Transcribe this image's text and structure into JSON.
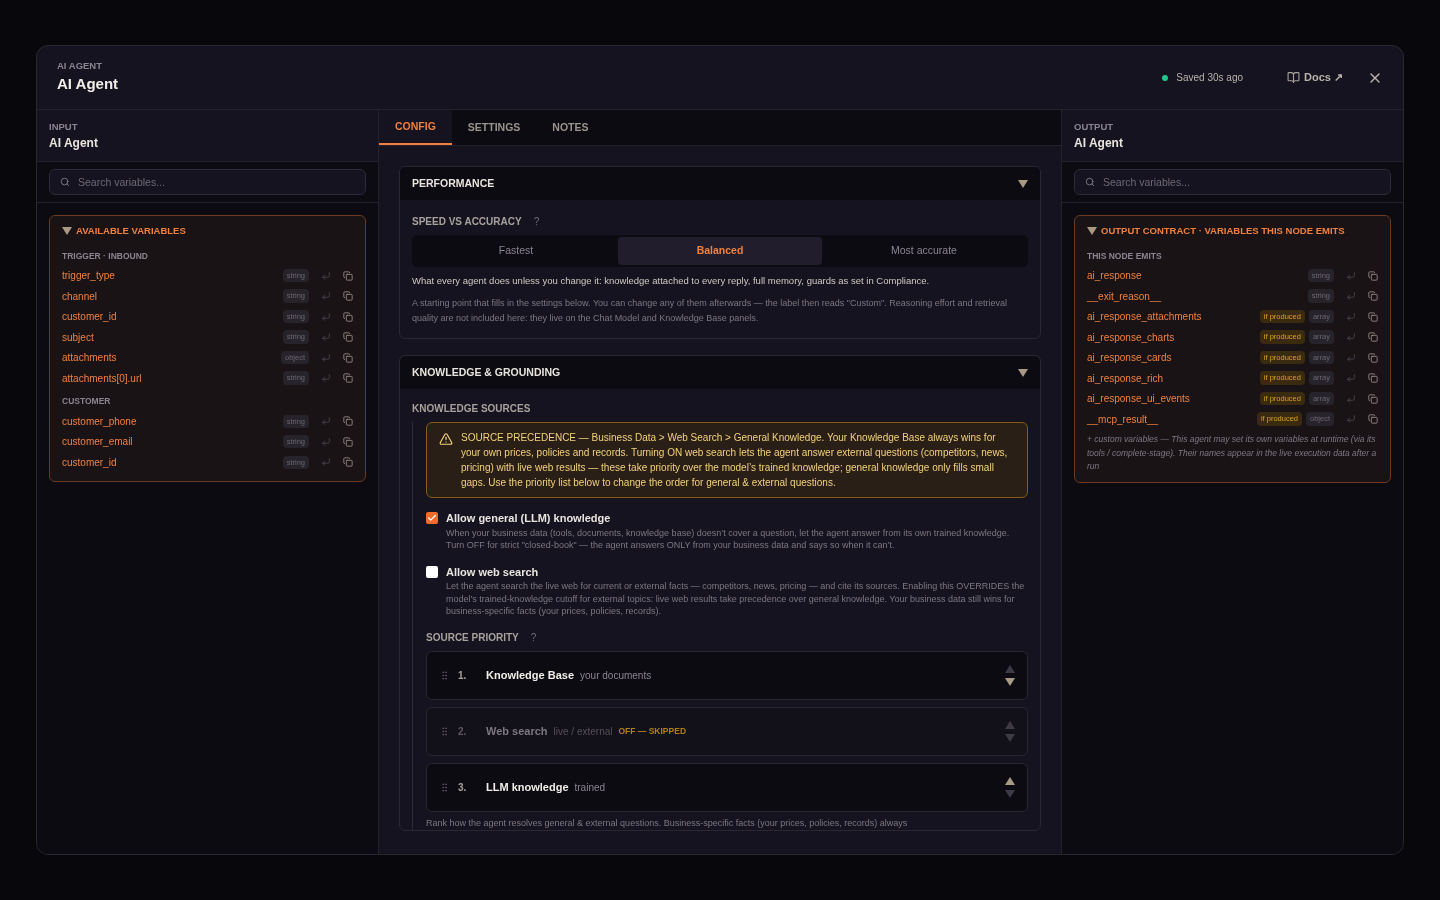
{
  "header": {
    "eyebrow": "AI AGENT",
    "title": "AI Agent",
    "status": "Saved 30s ago",
    "docs_link": "Docs ↗"
  },
  "input_panel": {
    "eyebrow": "INPUT",
    "title": "AI Agent",
    "search_placeholder": "Search variables...",
    "section_title": "AVAILABLE VARIABLES",
    "expanded": true,
    "groups": [
      {
        "label": "TRIGGER · INBOUND",
        "variables": [
          {
            "name": "trigger_type",
            "type": "string"
          },
          {
            "name": "channel",
            "type": "string"
          },
          {
            "name": "customer_id",
            "type": "string"
          },
          {
            "name": "subject",
            "type": "string"
          },
          {
            "name": "attachments",
            "type": "object"
          },
          {
            "name": "attachments[0].url",
            "type": "string"
          }
        ]
      },
      {
        "label": "CUSTOMER",
        "variables": [
          {
            "name": "customer_phone",
            "type": "string"
          },
          {
            "name": "customer_email",
            "type": "string"
          },
          {
            "name": "customer_id",
            "type": "string"
          }
        ]
      }
    ]
  },
  "tabs": [
    {
      "label": "CONFIG",
      "selected": true
    },
    {
      "label": "SETTINGS",
      "selected": false
    },
    {
      "label": "NOTES",
      "selected": false
    }
  ],
  "performance": {
    "title": "PERFORMANCE",
    "expanded": true,
    "field_label": "SPEED VS ACCURACY",
    "help": "?",
    "options": [
      {
        "label": "Fastest",
        "selected": false
      },
      {
        "label": "Balanced",
        "selected": true
      },
      {
        "label": "Most accurate",
        "selected": false
      }
    ],
    "summary": "What every agent does unless you change it: knowledge attached to every reply, full memory, guards as set in Compliance.",
    "note": "A starting point that fills in the settings below. You can change any of them afterwards — the label then reads \"Custom\". Reasoning effort and retrieval quality are not included here: they live on the Chat Model and Knowledge Base panels."
  },
  "knowledge": {
    "title": "KNOWLEDGE & GROUNDING",
    "expanded": true,
    "sources_label": "KNOWLEDGE SOURCES",
    "warning": "SOURCE PRECEDENCE — Business Data > Web Search > General Knowledge. Your Knowledge Base always wins for your own prices, policies and records. Turning ON web search lets the agent answer external questions (competitors, news, pricing) with live web results — these take priority over the model’s trained knowledge; general knowledge only fills small gaps. Use the priority list below to change the order for general & external questions.",
    "options": [
      {
        "label": "Allow general (LLM) knowledge",
        "checked": true,
        "description": "When your business data (tools, documents, knowledge base) doesn’t cover a question, let the agent answer from its own trained knowledge. Turn OFF for strict \"closed-book\" — the agent answers ONLY from your business data and says so when it can’t."
      },
      {
        "label": "Allow web search",
        "checked": false,
        "description": "Let the agent search the live web for current or external facts — competitors, news, pricing — and cite its sources. Enabling this OVERRIDES the model’s trained-knowledge cutoff for external topics: live web results take precedence over general knowledge. Your business data still wins for business-specific facts (your prices, policies, records)."
      }
    ],
    "priority_label": "SOURCE PRIORITY",
    "priority_help": "?",
    "priority": [
      {
        "rank": "1.",
        "name": "Knowledge Base",
        "hint": "your documents",
        "disabled": false,
        "can_move_up": false,
        "can_move_down": true
      },
      {
        "rank": "2.",
        "name": "Web search",
        "hint": "live / external",
        "status": "OFF — SKIPPED",
        "disabled": true,
        "can_move_up": true,
        "can_move_down": true
      },
      {
        "rank": "3.",
        "name": "LLM knowledge",
        "hint": "trained",
        "disabled": false,
        "can_move_up": true,
        "can_move_down": false
      }
    ],
    "priority_note": "Rank how the agent resolves general & external questions. Business-specific facts (your prices, policies, records) always"
  },
  "output_panel": {
    "eyebrow": "OUTPUT",
    "title": "AI Agent",
    "search_placeholder": "Search variables...",
    "section_title": "OUTPUT CONTRACT · VARIABLES THIS NODE EMITS",
    "expanded": true,
    "group_label": "THIS NODE EMITS",
    "variables": [
      {
        "name": "ai_response",
        "type": "string"
      },
      {
        "name": "__exit_reason__",
        "type": "string"
      },
      {
        "name": "ai_response_attachments",
        "type": "array",
        "badge": "if produced"
      },
      {
        "name": "ai_response_charts",
        "type": "array",
        "badge": "if produced"
      },
      {
        "name": "ai_response_cards",
        "type": "array",
        "badge": "if produced"
      },
      {
        "name": "ai_response_rich",
        "type": "array",
        "badge": "if produced"
      },
      {
        "name": "ai_response_ui_events",
        "type": "array",
        "badge": "if produced"
      },
      {
        "name": "__mcp_result__",
        "type": "object",
        "badge": "if produced"
      }
    ],
    "footnote": "+ custom variables — This agent may set its own variables at runtime (via its tools / complete-stage). Their names appear in the live execution data after a run"
  }
}
